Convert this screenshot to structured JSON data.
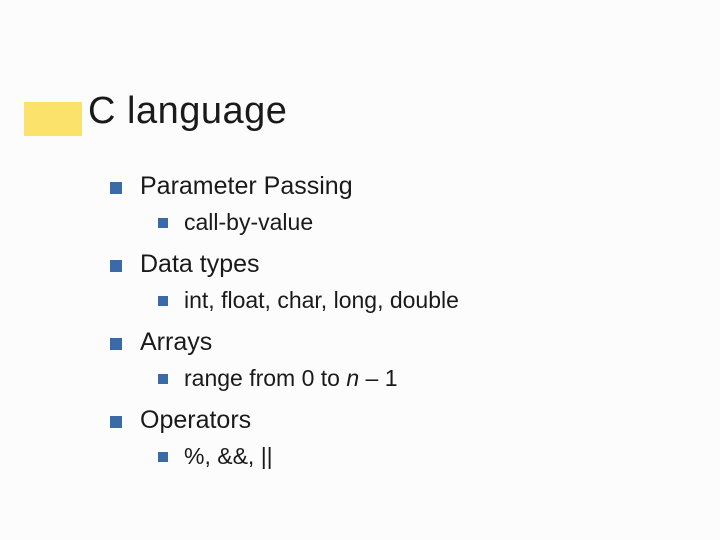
{
  "title": "C language",
  "items": [
    {
      "label": "Parameter Passing",
      "sub": {
        "text": "call-by-value"
      }
    },
    {
      "label": "Data types",
      "sub": {
        "text": "int, float, char, long, double"
      }
    },
    {
      "label": "Arrays",
      "sub": {
        "prefix": "range from 0 to ",
        "italic": "n",
        "suffix": " – 1"
      }
    },
    {
      "label": "Operators",
      "sub": {
        "text": "%, &&, ||"
      }
    }
  ]
}
